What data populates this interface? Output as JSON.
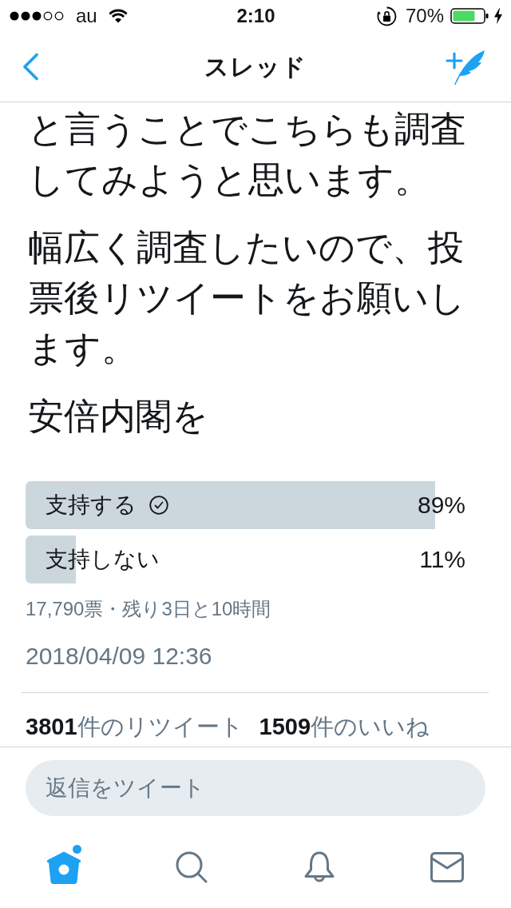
{
  "status_bar": {
    "carrier": "au",
    "time": "2:10",
    "battery": "70%",
    "rotation_lock": true,
    "charging": true
  },
  "nav": {
    "title": "スレッド"
  },
  "tweet": {
    "paragraphs": [
      "と言うことでこちらも調査してみようと思います。",
      "幅広く調査したいので、投票後リツイートをお願いします。",
      "安倍内閣を"
    ],
    "poll": {
      "options": [
        {
          "label": "支持する",
          "percent": "89%",
          "level": 0.89,
          "selected": true
        },
        {
          "label": "支持しない",
          "percent": "11%",
          "level": 0.11,
          "selected": false
        }
      ],
      "summary": "17,790票・残り3日と10時間"
    },
    "timestamp": "2018/04/09 12:36",
    "stats": [
      "**3801**件のリツイート",
      "**1509**件のいいね"
    ]
  },
  "reply": {
    "placeholder": "返信をツイート"
  },
  "tab_bar": [
    {
      "kind": "home",
      "selected": true,
      "new_dot": true
    },
    {
      "kind": "search",
      "selected": false,
      "new_dot": false
    },
    {
      "kind": "notifications",
      "selected": false,
      "new_dot": false
    },
    {
      "kind": "messages",
      "selected": false,
      "new_dot": false
    }
  ]
}
